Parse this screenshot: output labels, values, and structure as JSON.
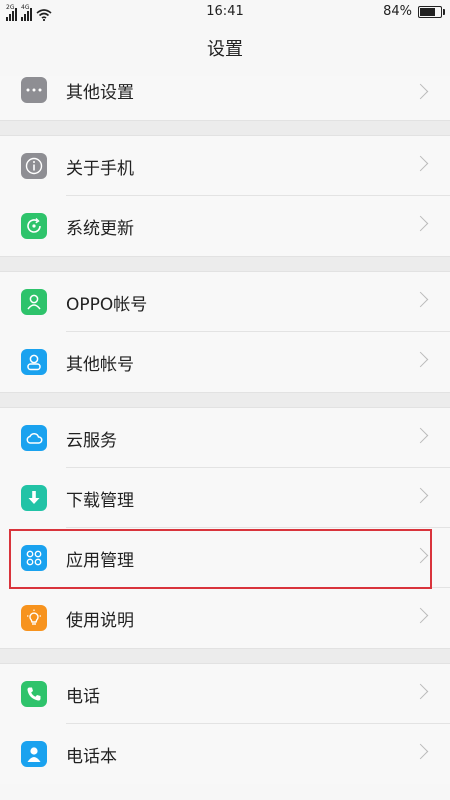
{
  "status": {
    "network1": "2G",
    "network2": "4G",
    "time": "16:41",
    "battery_text": "84%",
    "battery_level": 0.84
  },
  "title": "设置",
  "colors": {
    "gray_icon": "#8e8e93",
    "green_icon": "#2ec36b",
    "blue_icon": "#1aa2ef",
    "teal_icon": "#22c3a6",
    "orange_icon": "#f7931e",
    "highlight": "#d9343c"
  },
  "sections": [
    {
      "items": [
        {
          "label": "其他设置",
          "icon": "more-dots-icon"
        }
      ]
    },
    {
      "items": [
        {
          "label": "关于手机",
          "icon": "info-icon"
        },
        {
          "label": "系统更新",
          "icon": "update-icon"
        }
      ]
    },
    {
      "items": [
        {
          "label": "OPPO帐号",
          "icon": "account-icon"
        },
        {
          "label": "其他帐号",
          "icon": "person-icon"
        }
      ]
    },
    {
      "items": [
        {
          "label": "云服务",
          "icon": "cloud-icon"
        },
        {
          "label": "下载管理",
          "icon": "download-icon"
        },
        {
          "label": "应用管理",
          "icon": "apps-icon"
        },
        {
          "label": "使用说明",
          "icon": "bulb-icon"
        }
      ]
    },
    {
      "items": [
        {
          "label": "电话",
          "icon": "phone-icon"
        },
        {
          "label": "电话本",
          "icon": "contacts-icon"
        }
      ]
    }
  ]
}
